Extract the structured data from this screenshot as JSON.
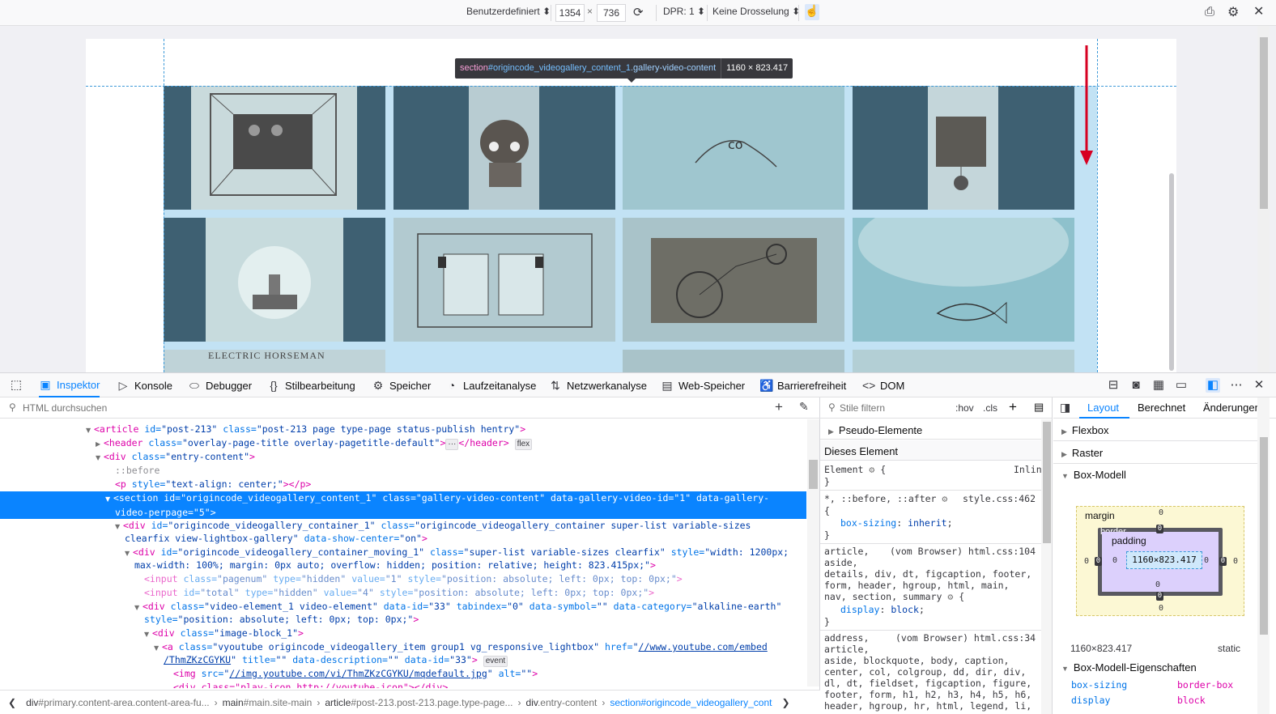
{
  "responsive_toolbar": {
    "device": "Benutzerdefiniert",
    "width": "1354",
    "times": "×",
    "height": "736",
    "dpr": "DPR: 1",
    "throttle": "Keine Drosselung"
  },
  "tooltip": {
    "tag": "section",
    "id": "#origincode_videogallery_content_1",
    "cls": ".gallery-video-content",
    "dims": "1160 × 823.417"
  },
  "gallery": {
    "partial_caption": "ELECTRIC HORSEMAN"
  },
  "devtools_tabs": [
    {
      "label": "Inspektor",
      "icon": "inspector-icon"
    },
    {
      "label": "Konsole",
      "icon": "console-icon"
    },
    {
      "label": "Debugger",
      "icon": "debugger-icon"
    },
    {
      "label": "Stilbearbeitung",
      "icon": "style-editor-icon"
    },
    {
      "label": "Speicher",
      "icon": "memory-icon"
    },
    {
      "label": "Laufzeitanalyse",
      "icon": "performance-icon"
    },
    {
      "label": "Netzwerkanalyse",
      "icon": "network-icon"
    },
    {
      "label": "Web-Speicher",
      "icon": "storage-icon"
    },
    {
      "label": "Barrierefreiheit",
      "icon": "accessibility-icon"
    },
    {
      "label": "DOM",
      "icon": "dom-icon"
    }
  ],
  "markup": {
    "search_placeholder": "HTML durchsuchen",
    "lines": {
      "l1_tag": "<article",
      "l1_a1": " id=",
      "l1_v1": "\"post-213\"",
      "l1_a2": " class=",
      "l1_v2": "\"post-213 page type-page status-publish hentry\"",
      "l1_end": ">",
      "l2_tag": "<header",
      "l2_a1": " class=",
      "l2_v1": "\"overlay-page-title overlay-pagetitle-default\"",
      "l2_mid": ">",
      "l2_ellipsis": "···",
      "l2_close": "</header>",
      "l2_badge": "flex",
      "l3_tag": "<div",
      "l3_a1": " class=",
      "l3_v1": "\"entry-content\"",
      "l3_end": ">",
      "l4": "::before",
      "l5_tag": "<p",
      "l5_a1": " style=",
      "l5_v1": "\"text-align: center;\"",
      "l5_end": "></p>",
      "l6a": "<section id=\"origincode_videogallery_content_1\" class=\"gallery-video-content\" data-gallery-video-id=\"1\" data-gallery-",
      "l6b": "video-perpage=\"5\">",
      "l7_tag": "<div",
      "l7_a1": " id=",
      "l7_v1": "\"origincode_videogallery_container_1\"",
      "l7_a2": " class=",
      "l7_v2": "\"origincode_videogallery_container super-list variable-sizes",
      "l7b_v": "clearfix view-lightbox-gallery\"",
      "l7b_a": " data-show-center=",
      "l7b_v2": "\"on\"",
      "l7b_end": ">",
      "l8_tag": "<div",
      "l8_a1": " id=",
      "l8_v1": "\"origincode_videogallery_container_moving_1\"",
      "l8_a2": " class=",
      "l8_v2": "\"super-list variable-sizes clearfix\"",
      "l8_a3": " style=",
      "l8_v3": "\"width: 1200px;",
      "l8b_v": "max-width: 100%; margin: 0px auto; overflow: hidden; position: relative; height: 823.415px;\"",
      "l8b_end": ">",
      "l9_tag": "<input",
      "l9_a1": " class=",
      "l9_v1": "\"pagenum\"",
      "l9_a2": " type=",
      "l9_v2": "\"hidden\"",
      "l9_a3": " value=",
      "l9_v3": "\"1\"",
      "l9_a4": " style=",
      "l9_v4": "\"position: absolute; left: 0px; top: 0px;\"",
      "l9_end": ">",
      "l10_tag": "<input",
      "l10_a1": " id=",
      "l10_v1": "\"total\"",
      "l10_a2": " type=",
      "l10_v2": "\"hidden\"",
      "l10_a3": " value=",
      "l10_v3": "\"4\"",
      "l10_a4": " style=",
      "l10_v4": "\"position: absolute; left: 0px; top: 0px;\"",
      "l10_end": ">",
      "l11_tag": "<div",
      "l11_a1": " class=",
      "l11_v1": "\"video-element_1 video-element\"",
      "l11_a2": " data-id=",
      "l11_v2": "\"33\"",
      "l11_a3": " tabindex=",
      "l11_v3": "\"0\"",
      "l11_a4": " data-symbol=",
      "l11_v4": "\"\"",
      "l11_a5": " data-category=",
      "l11_v5": "\"alkaline-earth\"",
      "l11b_a": "style=",
      "l11b_v": "\"position: absolute; left: 0px; top: 0px;\"",
      "l11b_end": ">",
      "l12_tag": "<div",
      "l12_a1": " class=",
      "l12_v1": "\"image-block_1\"",
      "l12_end": ">",
      "l13_tag": "<a",
      "l13_a1": " class=",
      "l13_v1": "\"vyoutube origincode_videogallery_item group1 vg_responsive_lightbox\"",
      "l13_a2": " href=",
      "l13_v2": "\"",
      "l13_u": "//www.youtube.com/embed",
      "l13b_u": "/ThmZKzCGYKU",
      "l13b_v": "\"",
      "l13b_a1": " title=",
      "l13b_v1": "\"\"",
      "l13b_a2": " data-description=",
      "l13b_v2": "\"\"",
      "l13b_a3": " data-id=",
      "l13b_v3": "\"33\"",
      "l13b_end": ">",
      "l13b_badge": "event",
      "l14_tag": "<img",
      "l14_a1": " src=",
      "l14_v1": "\"",
      "l14_u": "//img.youtube.com/vi/ThmZKzCGYKU/mqdefault.jpg",
      "l14_v1e": "\"",
      "l14_a2": " alt=",
      "l14_v2": "\"\"",
      "l14_end": ">",
      "l15": "<div class=\"play-icon http://youtube-icon\"></div>"
    }
  },
  "breadcrumbs": [
    {
      "tag": "div",
      "id": "#primary.content-area.content-area-fu..."
    },
    {
      "tag": "main",
      "id": "#main.site-main"
    },
    {
      "tag": "article",
      "id": "#post-213.post-213.page.type-page..."
    },
    {
      "tag": "div",
      "id": ".entry-content"
    },
    {
      "tag": "section",
      "id": "#origincode_videogallery_cont"
    }
  ],
  "rules": {
    "filter_placeholder": "Stile filtern",
    "hov": ":hov",
    "cls": ".cls",
    "pseudo": "Pseudo-Elemente",
    "this_element": "Dieses Element",
    "element_label": "Element",
    "inline": "Inline",
    "r1_sel": "*, ::before, ::after",
    "r1_src": "style.css:462",
    "r1_prop": "box-sizing",
    "r1_val": "inherit",
    "r2_sel1": "article,",
    "r2_src": "(vom Browser) html.css:104",
    "r2_sel2": "aside,",
    "r2_sel3": "details, div, dt, figcaption, footer,",
    "r2_sel4": "form, header, hgroup, html, main,",
    "r2_sel5": "nav, section, summary",
    "r2_prop": "display",
    "r2_val": "block",
    "r3_sel1": "address,",
    "r3_src": "(vom Browser) html.css:34",
    "r3_sel2": "article,",
    "r3_sel3": "aside, blockquote, body, caption,",
    "r3_sel4": "center, col, colgroup, dd, dir, div,",
    "r3_sel5": "dl, dt, fieldset, figcaption, figure,",
    "r3_sel6": "footer, form, h1, h2, h3, h4, h5, h6,",
    "r3_sel7": "header, hgroup, hr, html, legend, li,"
  },
  "layout": {
    "tab_layout": "Layout",
    "tab_computed": "Berechnet",
    "tab_changes": "Änderungen",
    "flexbox": "Flexbox",
    "grid": "Raster",
    "boxmodel": "Box-Modell",
    "margin_label": "margin",
    "border_label": "border",
    "padding_label": "padding",
    "content_size": "1160×823.417",
    "zero": "0",
    "size_line": "1160×823.417",
    "position": "static",
    "props_title": "Box-Modell-Eigenschaften",
    "prop1_name": "box-sizing",
    "prop1_val": "border-box",
    "prop2_name": "display",
    "prop2_val": "block"
  }
}
